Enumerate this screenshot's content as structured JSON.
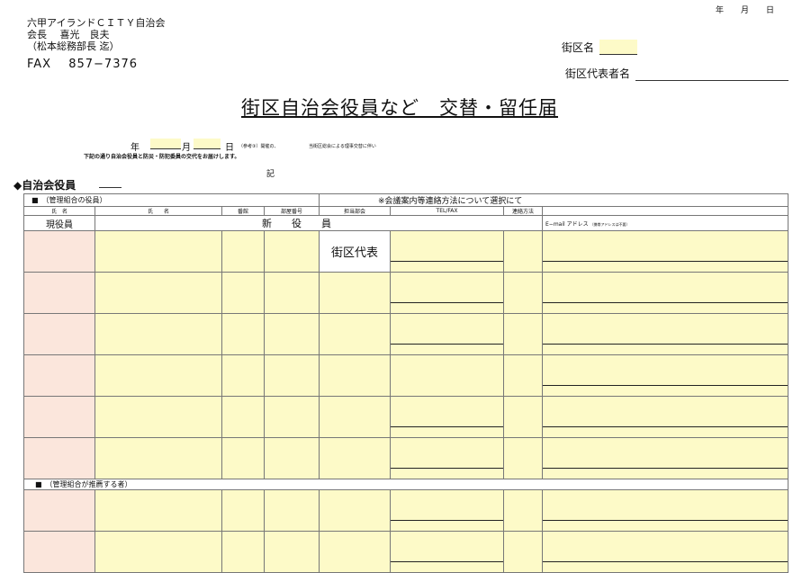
{
  "header": {
    "date_year": "年",
    "date_month": "月",
    "date_day": "日",
    "org": "六甲アイランドＣＩＴＹ自治会",
    "president": "会長　 喜光　良夫",
    "attn": "（松本総務部長 迄）",
    "fax": "FAX　 857−7376",
    "district_label": "街区名",
    "rep_label": "街区代表者名"
  },
  "title": "街区自治会役員など　交替・留任届",
  "intro": {
    "year": "年",
    "month": "月",
    "day": "日",
    "note1": "（参考③）開催の、",
    "note2": "当街区総会による理事交替に伴い",
    "line2": "下記の通り自治会役員と防災・防犯委員の交代をお届けします。",
    "ki": "記"
  },
  "section_title": "◆自治会役員",
  "table": {
    "group1_label": "■　（管理組合の役員）",
    "contact_note": "※会議案内等連絡方法について選択にて",
    "headers": [
      "氏　名",
      "氏　　名",
      "番館",
      "部屋番号",
      "担当部会",
      "TEL/FAX",
      "連絡方法",
      ""
    ],
    "row_genyaku": "現役員",
    "row_shin": "新　　役　　員",
    "email_label": "E−mail アドレス",
    "email_note": "（携帯アドレスは不要）",
    "district_rep": "街区代表",
    "group2_label": "■　（管理組合が推薦する者）"
  }
}
